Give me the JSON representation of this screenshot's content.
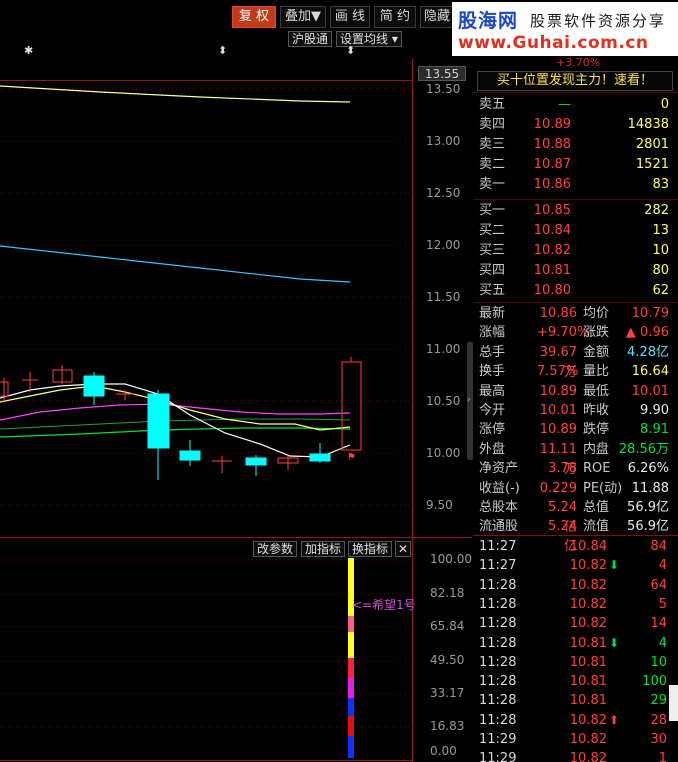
{
  "toolbar": {
    "fuquan": "复 权",
    "diejia": "叠加▼",
    "huaxian": "画 线",
    "jianyue": "简 约",
    "yincang": "隐藏"
  },
  "logo": {
    "name": "股海网",
    "slogan": "股票软件资源分享",
    "url": "www.Guhai.com.cn"
  },
  "subtoolbar": {
    "hugutong": "沪股通",
    "shezhi_junxian": "设置均线 ▾",
    "markers": [
      "✱",
      "⬍",
      "⬍"
    ]
  },
  "price_axis": {
    "current": "13.55",
    "ticks": [
      "13.50",
      "13.00",
      "12.50",
      "12.00",
      "11.50",
      "11.00",
      "10.50",
      "10.00",
      "9.50"
    ]
  },
  "limit_up_flag": "⚑",
  "indicator": {
    "buttons": [
      "改参数",
      "加指标",
      "换指标",
      "✕"
    ],
    "label": "<=希望1号",
    "axis": [
      "100.00",
      "82.18",
      "65.84",
      "49.50",
      "33.17",
      "16.83",
      "0.00"
    ]
  },
  "promo": "买十位置发现主力！速看！",
  "top_cut_text": "+3.70%",
  "order_book": {
    "asks": [
      {
        "label": "卖五",
        "price": "—",
        "vol": "0"
      },
      {
        "label": "卖四",
        "price": "10.89",
        "vol": "14838"
      },
      {
        "label": "卖三",
        "price": "10.88",
        "vol": "2801"
      },
      {
        "label": "卖二",
        "price": "10.87",
        "vol": "1521"
      },
      {
        "label": "卖一",
        "price": "10.86",
        "vol": "83"
      }
    ],
    "bids": [
      {
        "label": "买一",
        "price": "10.85",
        "vol": "282"
      },
      {
        "label": "买二",
        "price": "10.84",
        "vol": "13"
      },
      {
        "label": "买三",
        "price": "10.82",
        "vol": "10"
      },
      {
        "label": "买四",
        "price": "10.81",
        "vol": "80"
      },
      {
        "label": "买五",
        "price": "10.80",
        "vol": "62"
      }
    ]
  },
  "stats": [
    {
      "l1": "最新",
      "v1": "10.86",
      "c1": "red",
      "l2": "均价",
      "v2": "10.79",
      "c2": "red"
    },
    {
      "l1": "涨幅",
      "v1": "+9.70%",
      "c1": "red",
      "l2": "涨跌",
      "v2": "▲ 0.96",
      "c2": "red"
    },
    {
      "l1": "总手",
      "v1": "39.67万",
      "c1": "yellow",
      "l2": "金额",
      "v2": "4.28亿",
      "c2": "cyan"
    },
    {
      "l1": "换手",
      "v1": "7.57%",
      "c1": "yellow",
      "l2": "量比",
      "v2": "16.64",
      "c2": "yellow"
    },
    {
      "l1": "最高",
      "v1": "10.89",
      "c1": "red",
      "l2": "最低",
      "v2": "10.01",
      "c2": "red"
    },
    {
      "l1": "今开",
      "v1": "10.01",
      "c1": "red",
      "l2": "昨收",
      "v2": "9.90",
      "c2": "white"
    },
    {
      "l1": "涨停",
      "v1": "10.89",
      "c1": "red",
      "l2": "跌停",
      "v2": "8.91",
      "c2": "green"
    },
    {
      "l1": "外盘",
      "v1": "11.11万",
      "c1": "red",
      "l2": "内盘",
      "v2": "28.56万",
      "c2": "green"
    },
    {
      "l1": "净资产",
      "v1": "3.78",
      "c1": "white",
      "l2": "ROE",
      "v2": "6.26%",
      "c2": "white"
    },
    {
      "l1": "收益(-)",
      "v1": "0.229",
      "c1": "white",
      "l2": "PE(动)",
      "v2": "11.88",
      "c2": "white"
    },
    {
      "l1": "总股本",
      "v1": "5.24亿",
      "c1": "white",
      "l2": "总值",
      "v2": "56.9亿",
      "c2": "white"
    },
    {
      "l1": "流通股",
      "v1": "5.24亿",
      "c1": "white",
      "l2": "流值",
      "v2": "56.9亿",
      "c2": "white"
    }
  ],
  "ticks": [
    {
      "time": "11:27",
      "price": "10.84",
      "arrow": "",
      "vol": "84",
      "c": "red"
    },
    {
      "time": "11:27",
      "price": "10.82",
      "arrow": "⬇",
      "ac": "green",
      "vol": "4",
      "c": "red"
    },
    {
      "time": "11:28",
      "price": "10.82",
      "arrow": "",
      "vol": "64",
      "c": "red"
    },
    {
      "time": "11:28",
      "price": "10.82",
      "arrow": "",
      "vol": "5",
      "c": "red"
    },
    {
      "time": "11:28",
      "price": "10.82",
      "arrow": "",
      "vol": "14",
      "c": "red"
    },
    {
      "time": "11:28",
      "price": "10.81",
      "arrow": "⬇",
      "ac": "green",
      "vol": "4",
      "c": "green"
    },
    {
      "time": "11:28",
      "price": "10.81",
      "arrow": "",
      "vol": "10",
      "c": "green"
    },
    {
      "time": "11:28",
      "price": "10.81",
      "arrow": "",
      "vol": "100",
      "c": "green"
    },
    {
      "time": "11:28",
      "price": "10.81",
      "arrow": "",
      "vol": "29",
      "c": "green"
    },
    {
      "time": "11:28",
      "price": "10.82",
      "arrow": "⬆",
      "ac": "red",
      "vol": "28",
      "c": "red"
    },
    {
      "time": "11:29",
      "price": "10.82",
      "arrow": "",
      "vol": "30",
      "c": "red"
    },
    {
      "time": "11:29",
      "price": "10.82",
      "arrow": "",
      "vol": "1",
      "c": "red"
    }
  ],
  "colors": {
    "up": "#ff4040",
    "down": "#00ffff",
    "ma5": "#ffffff",
    "ma10": "#ffff80",
    "ma20": "#ff40ff",
    "ma60": "#00e040",
    "ma120": "#40c0ff"
  }
}
